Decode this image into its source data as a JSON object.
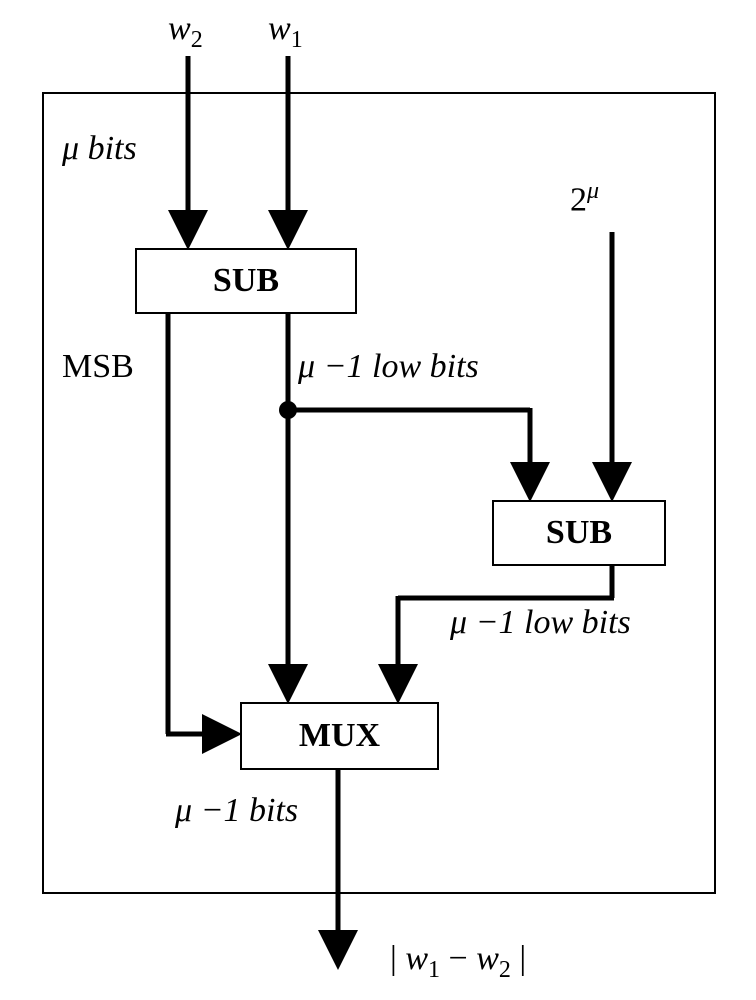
{
  "inputs": {
    "w2": "w",
    "w2_sub": "2",
    "w1": "w",
    "w1_sub": "1",
    "two_mu": "2",
    "two_mu_sup": "μ"
  },
  "labels": {
    "mu_bits": "μ bits",
    "msb": "MSB",
    "mu_minus1_low": "μ −1 low bits",
    "mu_minus1_low2": "μ −1 low bits",
    "mu_minus1_bits": "μ −1 bits"
  },
  "blocks": {
    "sub1": "SUB",
    "sub2": "SUB",
    "mux": "MUX"
  },
  "output": {
    "abs_prefix": "| ",
    "w1": "w",
    "w1_sub": "1",
    "minus": " − ",
    "w2": "w",
    "w2_sub": "2",
    "abs_suffix": " |"
  }
}
